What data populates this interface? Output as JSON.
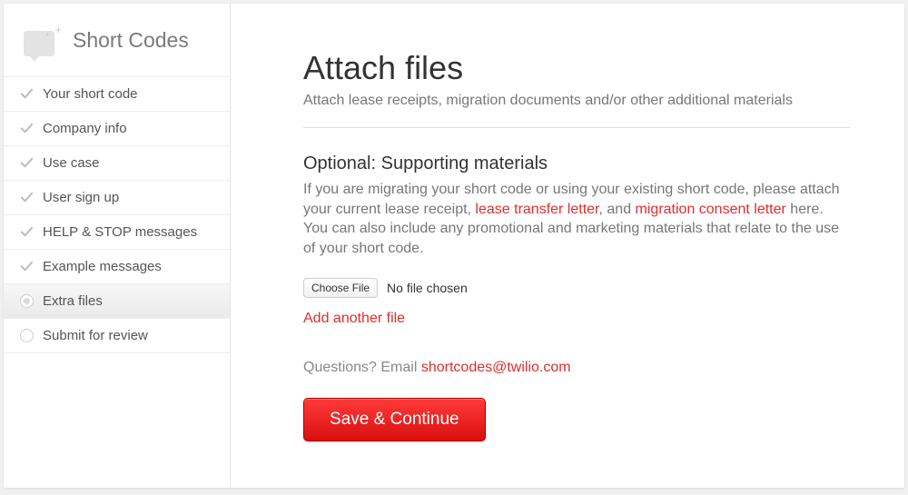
{
  "sidebar": {
    "title": "Short Codes",
    "items": [
      {
        "label": "Your short code",
        "status": "done"
      },
      {
        "label": "Company info",
        "status": "done"
      },
      {
        "label": "Use case",
        "status": "done"
      },
      {
        "label": "User sign up",
        "status": "done"
      },
      {
        "label": "HELP & STOP messages",
        "status": "done"
      },
      {
        "label": "Example messages",
        "status": "done"
      },
      {
        "label": "Extra files",
        "status": "active"
      },
      {
        "label": "Submit for review",
        "status": "pending"
      }
    ]
  },
  "main": {
    "title": "Attach files",
    "subtitle": "Attach lease receipts, migration documents and/or other additional materials",
    "section_title": "Optional: Supporting materials",
    "desc_part1": "If you are migrating your short code or using your existing short code, please attach your current lease receipt, ",
    "desc_link1": "lease transfer letter",
    "desc_part2": ", and ",
    "desc_link2": "migration consent letter",
    "desc_part3": " here. You can also include any promotional and marketing materials that relate to the use of your short code.",
    "choose_file_label": "Choose File",
    "file_status": "No file chosen",
    "add_another_label": "Add another file",
    "questions_prefix": "Questions? Email ",
    "questions_email": "shortcodes@twilio.com",
    "save_label": "Save & Continue"
  }
}
